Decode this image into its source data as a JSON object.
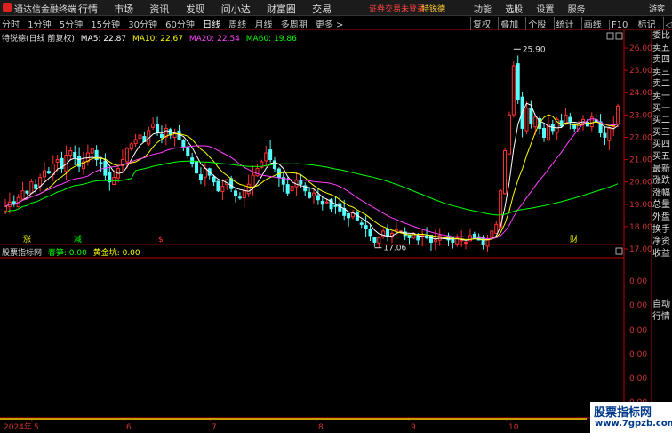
{
  "titlebar": {
    "app_title": "通达信金融终端",
    "menus": [
      "行情",
      "市场",
      "资讯",
      "发现",
      "问小达",
      "财富圈",
      "交易"
    ],
    "notice": "证券交易未登录",
    "notice_stock": "特锐德",
    "right_menus": [
      "功能",
      "选股",
      "设置",
      "服务"
    ],
    "guest": "游客"
  },
  "periods": [
    "分时",
    "1分钟",
    "5分钟",
    "15分钟",
    "30分钟",
    "60分钟",
    "日线",
    "周线",
    "月线",
    "多周期",
    "更多 >"
  ],
  "active_period": "日线",
  "right_tools": [
    "复权",
    "叠加",
    "个股",
    "统计",
    "画线",
    "F10",
    "标记",
    "◁返回"
  ],
  "ma": {
    "stock": "特锐德(日线 前复权)",
    "ma5": "MA5: 22.87",
    "ma10": "MA10: 22.67",
    "ma20": "MA20: 22.54",
    "ma60": "MA60: 19.86"
  },
  "indicator": {
    "name": "股票指标网",
    "chunsun": "春笋: 0.00",
    "huangjinkang": "黄金坑: 0.00"
  },
  "price_axis": [
    "26.00",
    "25.00",
    "24.00",
    "23.00",
    "22.00",
    "21.00",
    "20.00",
    "19.00",
    "18.00",
    "17.00"
  ],
  "ind_axis": [
    "0.00",
    "0.00",
    "0.00",
    "0.00",
    "0.00",
    "0.00",
    "0.00",
    "0.00"
  ],
  "annotations": {
    "high": "25.90",
    "low": "17.06"
  },
  "markers": [
    "涨",
    "减",
    "$",
    "财"
  ],
  "date_labels": [
    "2024年",
    "5",
    "6",
    "7",
    "8",
    "9",
    "10",
    "11"
  ],
  "side_panel": [
    "委比",
    "卖五",
    "卖四",
    "卖三",
    "卖二",
    "卖一",
    "买一",
    "买二",
    "买三",
    "买四",
    "买五",
    "最新",
    "涨跌",
    "涨幅",
    "总量",
    "外盘",
    "换手",
    "净资",
    "收益"
  ],
  "side_panel2": [
    "自动",
    "行情"
  ],
  "watermark": {
    "line1": "股票指标网",
    "line2": "www.7gpzb.com"
  },
  "colors": {
    "up": "#ff3232",
    "down": "#54ffff",
    "ma5": "#ffffff",
    "ma10": "#ffff00",
    "ma20": "#ff40ff",
    "ma60": "#00ff00",
    "axis": "#c00000"
  }
}
